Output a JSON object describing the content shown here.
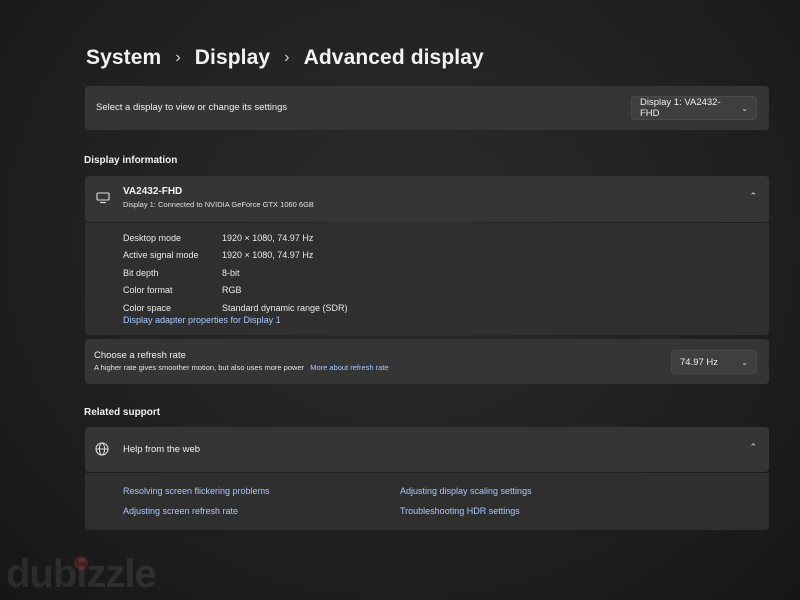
{
  "breadcrumb": {
    "items": [
      "System",
      "Display",
      "Advanced display"
    ],
    "separator": "›"
  },
  "display_select": {
    "label": "Select a display to view or change its settings",
    "selected": "Display 1: VA2432-FHD"
  },
  "display_info": {
    "section_title": "Display information",
    "name": "VA2432-FHD",
    "subtitle": "Display 1: Connected to NVIDIA GeForce GTX 1060 6GB",
    "rows": [
      {
        "key": "Desktop mode",
        "value": "1920 × 1080, 74.97 Hz"
      },
      {
        "key": "Active signal mode",
        "value": "1920 × 1080, 74.97 Hz"
      },
      {
        "key": "Bit depth",
        "value": "8-bit"
      },
      {
        "key": "Color format",
        "value": "RGB"
      },
      {
        "key": "Color space",
        "value": "Standard dynamic range (SDR)"
      }
    ],
    "adapter_link": "Display adapter properties for Display 1"
  },
  "refresh": {
    "title": "Choose a refresh rate",
    "subtitle": "A higher rate gives smoother motion, but also uses more power",
    "more_link": "More about refresh rate",
    "selected": "74.97 Hz"
  },
  "related": {
    "section_title": "Related support",
    "help_title": "Help from the web",
    "links": [
      "Resolving screen flickering problems",
      "Adjusting display scaling settings",
      "Adjusting screen refresh rate",
      "Troubleshooting HDR settings"
    ]
  },
  "watermark": "dubizzle",
  "icons": {
    "monitor": "monitor-icon",
    "globe": "globe-icon",
    "chevron_down": "chevron-down-icon",
    "chevron_up": "chevron-up-icon"
  },
  "colors": {
    "background": "#202020",
    "card": "#353535",
    "link": "#a8c9ff"
  }
}
